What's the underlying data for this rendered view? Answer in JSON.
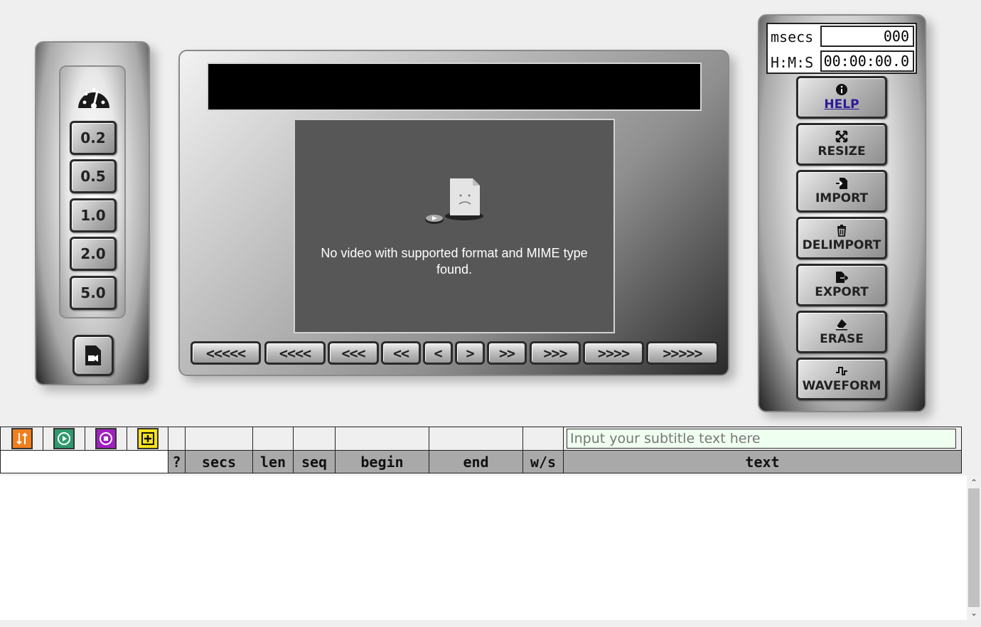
{
  "speed_panel": {
    "icon": "gauge-icon",
    "rates": [
      "0.2",
      "0.5",
      "1.0",
      "2.0",
      "5.0"
    ],
    "bottom_icon": "video-file-icon"
  },
  "player": {
    "video_message": "No video with supported format and MIME type found.",
    "nav_buttons": [
      "<<<<<",
      "<<<<",
      "<<<",
      "<<",
      "<",
      ">",
      ">>",
      ">>>",
      ">>>>",
      ">>>>>"
    ]
  },
  "time": {
    "msecs_label": "msecs",
    "msecs_value": "000",
    "hms_label": "H:M:S",
    "hms_value": "00:00:00.0"
  },
  "side_buttons": {
    "help": "HELP",
    "resize": "RESIZE",
    "import": "IMPORT",
    "delimport": "DELIMPORT",
    "export": "EXPORT",
    "erase": "ERASE",
    "waveform": "WAVEFORM"
  },
  "table": {
    "subtitle_placeholder": "Input your subtitle text here",
    "toolbar_icons": [
      {
        "name": "swap-icon",
        "color": "#f07f1e"
      },
      {
        "name": "play-icon",
        "color": "#2f9a6e"
      },
      {
        "name": "stop-icon",
        "color": "#a020c0"
      },
      {
        "name": "add-icon",
        "color": "#f5e21a"
      }
    ],
    "headers": [
      "?",
      "secs",
      "len",
      "seq",
      "begin",
      "end",
      "w/s",
      "text"
    ]
  }
}
